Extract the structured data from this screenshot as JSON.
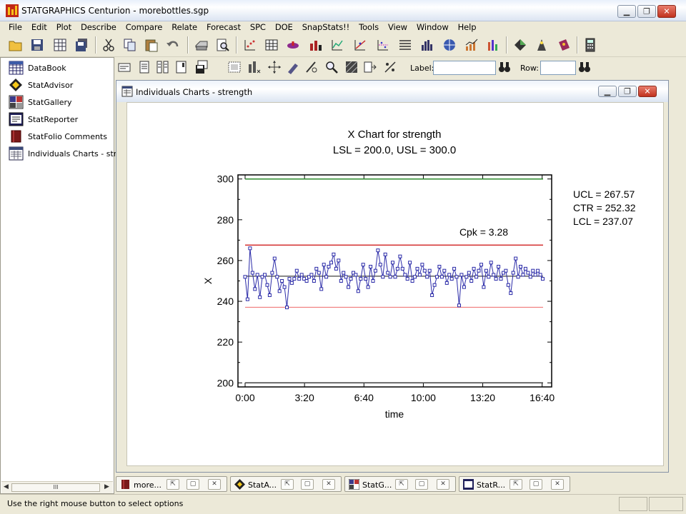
{
  "window": {
    "title": "STATGRAPHICS Centurion - morebottles.sgp"
  },
  "menu": [
    "File",
    "Edit",
    "Plot",
    "Describe",
    "Compare",
    "Relate",
    "Forecast",
    "SPC",
    "DOE",
    "SnapStats!!",
    "Tools",
    "View",
    "Window",
    "Help"
  ],
  "sidebar": {
    "items": [
      {
        "label": "DataBook",
        "icon": "grid-icon"
      },
      {
        "label": "StatAdvisor",
        "icon": "advisor-icon"
      },
      {
        "label": "StatGallery",
        "icon": "gallery-icon"
      },
      {
        "label": "StatReporter",
        "icon": "reporter-icon"
      },
      {
        "label": "StatFolio Comments",
        "icon": "book-icon"
      },
      {
        "label": "Individuals Charts - streng",
        "icon": "chart-icon"
      }
    ]
  },
  "toolbar2": {
    "label_text": "Label:",
    "label_value": "",
    "row_text": "Row:",
    "row_value": ""
  },
  "child": {
    "title": "Individuals Charts - strength"
  },
  "chart_data": {
    "type": "line",
    "title": "X Chart for strength",
    "subtitle": "LSL = 200.0, USL = 300.0",
    "xlabel": "time",
    "ylabel": "X",
    "ylim": [
      198,
      302
    ],
    "xlim": [
      0,
      17.2
    ],
    "yticks": [
      "200",
      "220",
      "240",
      "260",
      "280",
      "300"
    ],
    "xticks": [
      "0:00",
      "3:20",
      "6:40",
      "10:00",
      "13:20",
      "16:40"
    ],
    "annotation": "Cpk = 3.28",
    "control_labels": [
      "UCL = 267.57",
      "CTR = 252.32",
      "LCL = 237.07"
    ],
    "limits": {
      "UCL": 267.57,
      "CTR": 252.32,
      "LCL": 237.07,
      "LSL": 200.0,
      "USL": 300.0
    },
    "colors": {
      "series": "#2a2aa8",
      "ucl": "#d02020",
      "lcl": "#f07a7a",
      "ctr": "#404040",
      "usl": "#2c8a2c",
      "lsl": "#404040"
    },
    "series": [
      {
        "values": [
          252,
          241,
          266,
          254,
          246,
          253,
          242,
          252,
          253,
          248,
          243,
          254,
          261,
          252,
          245,
          250,
          247,
          237,
          251,
          249,
          251,
          255,
          251,
          253,
          251,
          250,
          252,
          253,
          250,
          256,
          254,
          246,
          258,
          252,
          257,
          259,
          263,
          256,
          260,
          250,
          254,
          252,
          247,
          251,
          254,
          253,
          245,
          251,
          258,
          251,
          247,
          257,
          250,
          255,
          265,
          258,
          252,
          263,
          254,
          252,
          259,
          252,
          256,
          262,
          256,
          253,
          251,
          259,
          250,
          252,
          256,
          253,
          258,
          255,
          252,
          255,
          243,
          248,
          252,
          257,
          252,
          255,
          249,
          253,
          251,
          256,
          252,
          238,
          253,
          247,
          252,
          254,
          250,
          256,
          252,
          255,
          258,
          247,
          255,
          252,
          259,
          253,
          251,
          257,
          251,
          254,
          255,
          248,
          244,
          254,
          261,
          252,
          257,
          253,
          256,
          254,
          252,
          255,
          253,
          255,
          253,
          251
        ]
      }
    ]
  },
  "tasks": [
    {
      "label": "more...",
      "icon": "book-icon"
    },
    {
      "label": "StatA...",
      "icon": "advisor-icon"
    },
    {
      "label": "StatG...",
      "icon": "gallery-icon"
    },
    {
      "label": "StatR...",
      "icon": "reporter-icon"
    }
  ],
  "status": {
    "message": "Use the right mouse button to select options"
  },
  "scroll": {
    "thumb": "III"
  }
}
